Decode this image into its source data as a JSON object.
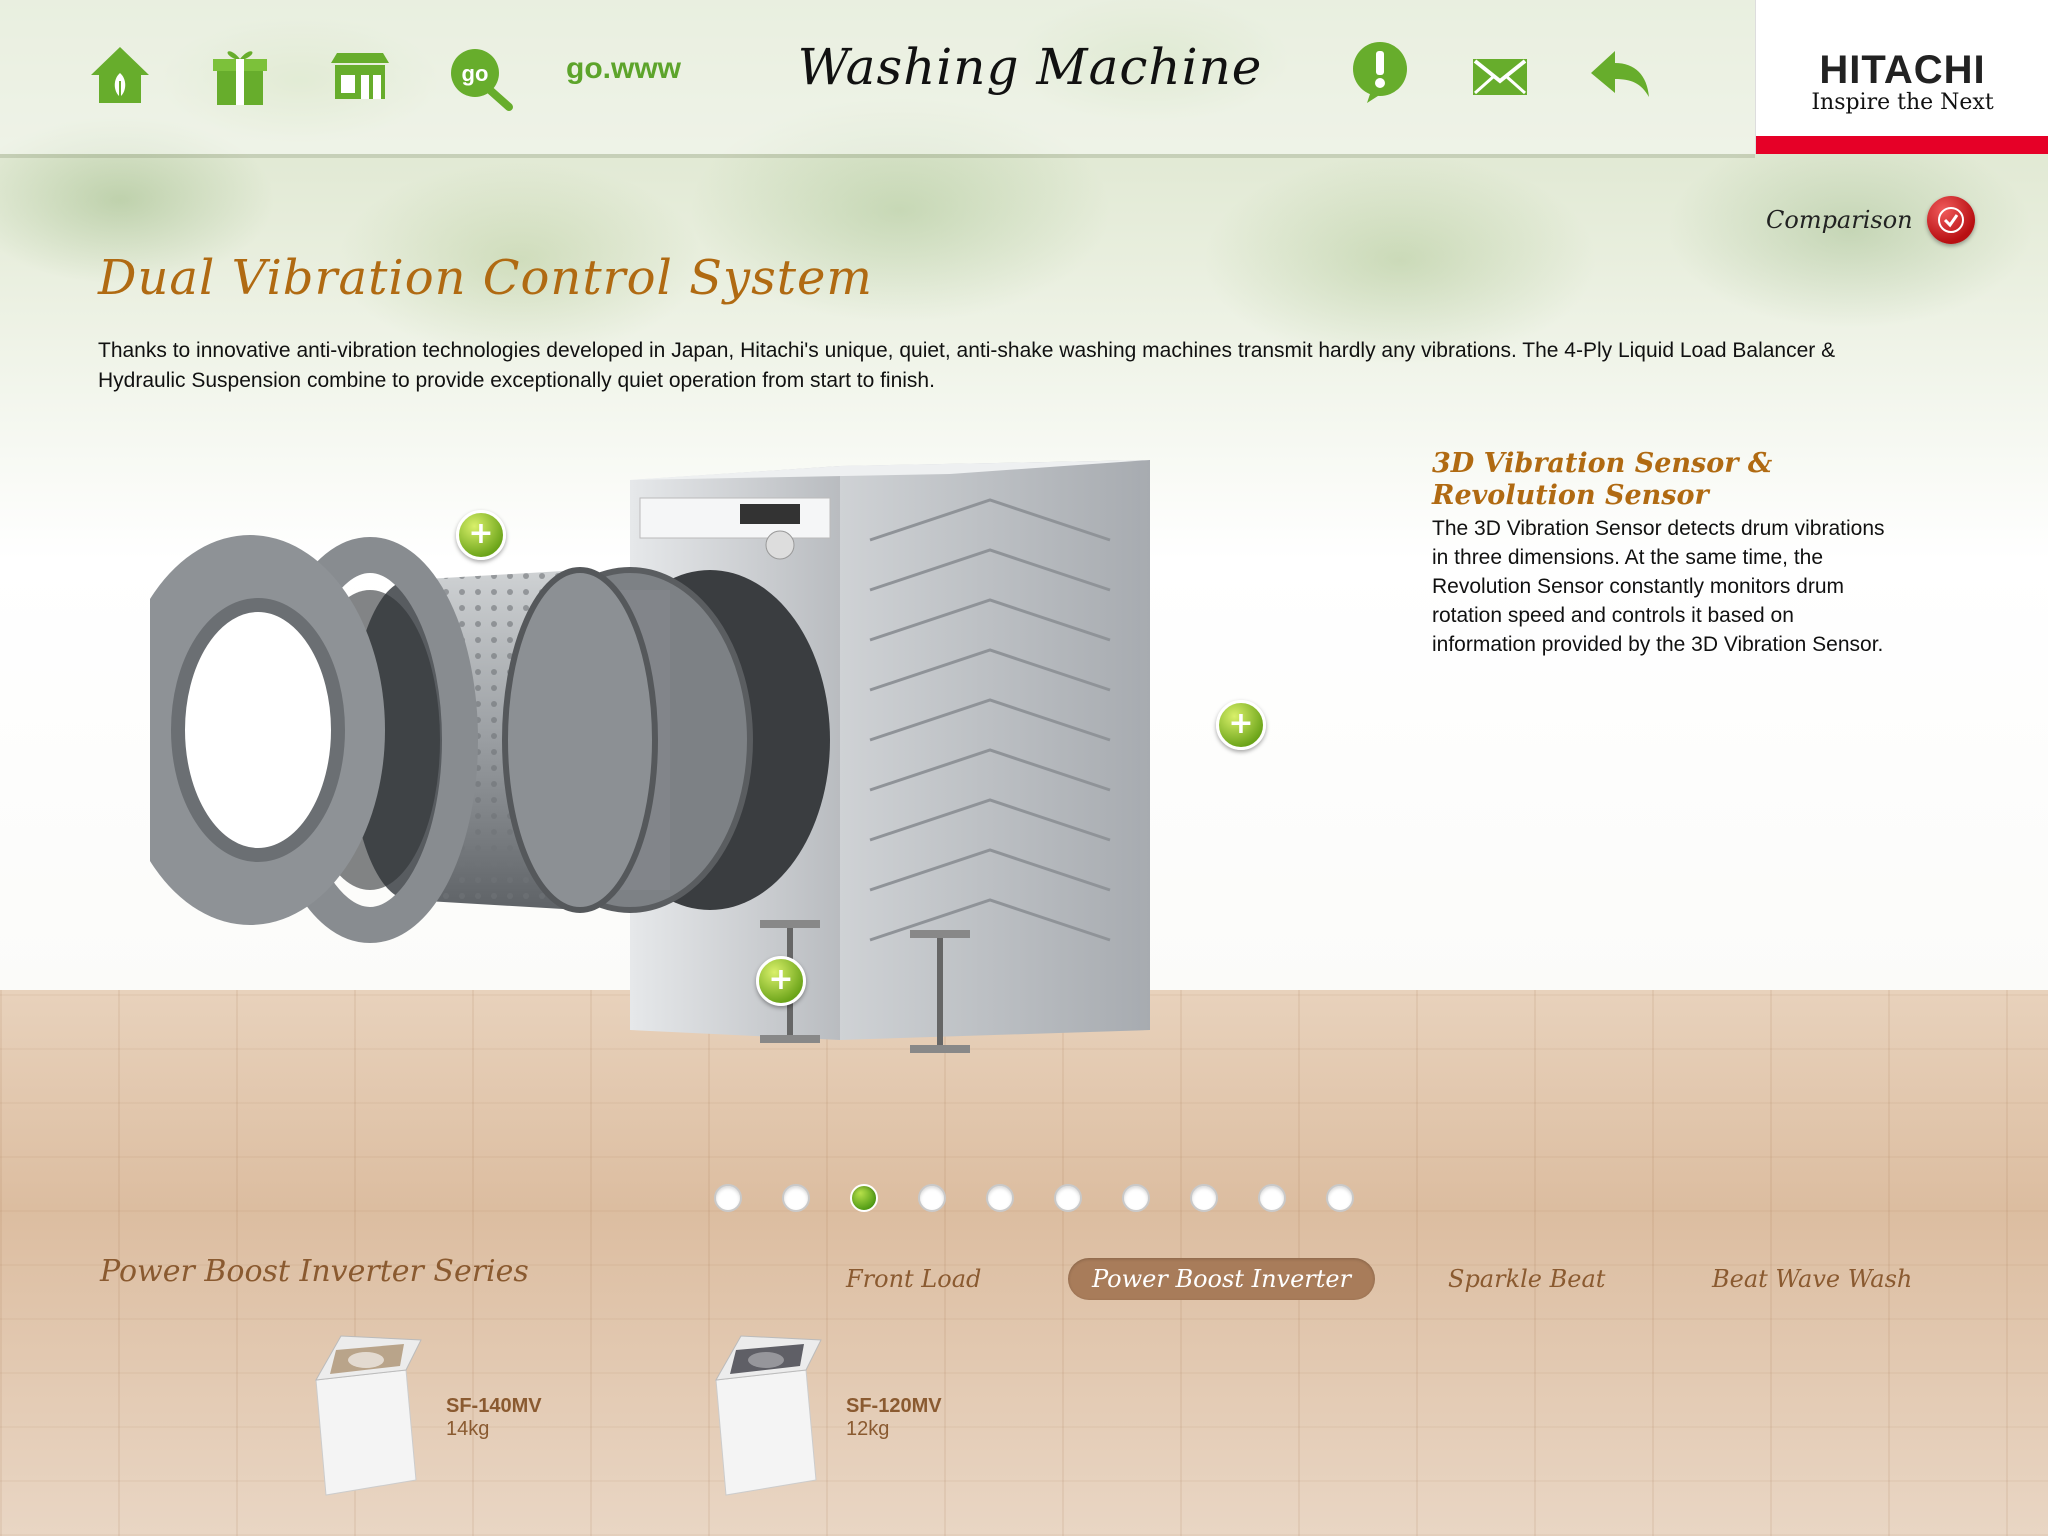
{
  "header": {
    "title": "Washing Machine",
    "go_www": "go.www",
    "icons": [
      "home-icon",
      "gift-icon",
      "store-icon",
      "go-search-icon",
      "info-icon",
      "mail-icon",
      "back-icon"
    ]
  },
  "logo": {
    "brand": "HITACHI",
    "tagline": "Inspire the Next"
  },
  "comparison": {
    "label": "Comparison"
  },
  "main": {
    "heading": "Dual Vibration Control System",
    "description": "Thanks to innovative anti-vibration technologies developed in Japan, Hitachi's unique, quiet, anti-shake washing machines transmit hardly any vibrations. The 4-Ply Liquid Load Balancer & Hydraulic Suspension combine to provide exceptionally quiet operation from start to finish."
  },
  "feature": {
    "title": "3D Vibration Sensor & Revolution Sensor",
    "description": "The 3D Vibration Sensor detects drum vibrations in three dimensions. At the same time, the Revolution Sensor constantly monitors drum rotation speed and controls it based on information provided by the 3D Vibration Sensor."
  },
  "hotspot_symbol": "+",
  "pagination": {
    "total": 10,
    "active_index": 2
  },
  "series": {
    "title": "Power Boost Inverter Series",
    "tabs": [
      {
        "label": "Front Load",
        "active": false
      },
      {
        "label": "Power Boost Inverter",
        "active": true
      },
      {
        "label": "Sparkle Beat",
        "active": false
      },
      {
        "label": "Beat Wave Wash",
        "active": false
      }
    ]
  },
  "products": [
    {
      "model": "SF-140MV",
      "capacity": "14kg",
      "lid_color": "#b9a48a"
    },
    {
      "model": "SF-120MV",
      "capacity": "12kg",
      "lid_color": "#5f5f66"
    }
  ],
  "colors": {
    "accent_green": "#5da42b",
    "heading_brown": "#b06a12",
    "logo_red": "#e60027"
  }
}
